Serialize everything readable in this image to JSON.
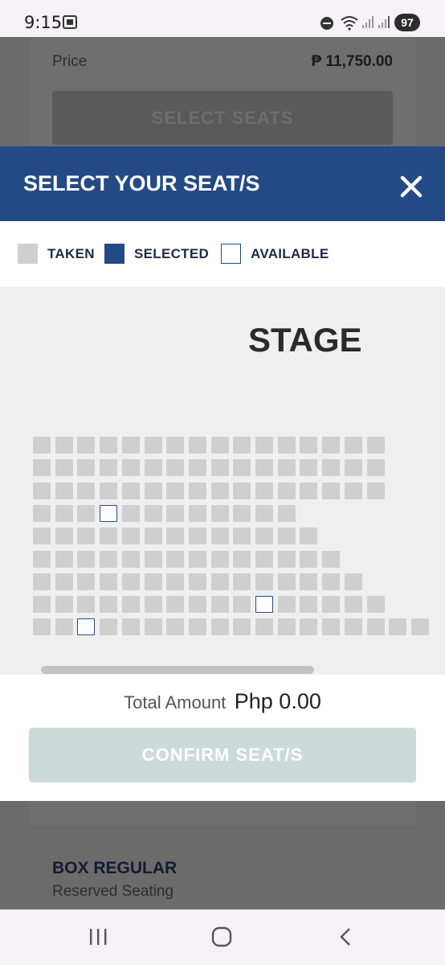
{
  "status_bar": {
    "time": "9:15",
    "battery": "97"
  },
  "background": {
    "price_label": "Price",
    "price_value": "₱ 11,750.00",
    "select_seats_label": "SELECT SEATS",
    "box_title": "BOX REGULAR",
    "box_subtitle": "Reserved Seating"
  },
  "modal": {
    "title": "SELECT YOUR SEAT/S",
    "close_icon": "close-icon",
    "legend": [
      {
        "label": "TAKEN",
        "state": "taken"
      },
      {
        "label": "SELECTED",
        "state": "selected"
      },
      {
        "label": "AVAILABLE",
        "state": "available"
      }
    ],
    "stage_label": "STAGE",
    "seat_rows": [
      {
        "count": 16,
        "available": []
      },
      {
        "count": 16,
        "available": []
      },
      {
        "count": 16,
        "available": []
      },
      {
        "count": 12,
        "available": [
          3
        ]
      },
      {
        "count": 13,
        "available": []
      },
      {
        "count": 14,
        "available": []
      },
      {
        "count": 15,
        "available": []
      },
      {
        "count": 16,
        "available": [
          10
        ]
      },
      {
        "count": 18,
        "available": [
          2
        ]
      }
    ],
    "total_label": "Total Amount",
    "total_value": "Php 0.00",
    "confirm_label": "CONFIRM SEAT/S"
  },
  "colors": {
    "header": "#234a85",
    "taken": "#cfcfcf",
    "selected": "#234a85",
    "available": "#ffffff",
    "confirm_disabled": "#cddbd8"
  },
  "nav_bar": {
    "icons": [
      "recent-apps-icon",
      "home-icon",
      "back-icon"
    ]
  }
}
